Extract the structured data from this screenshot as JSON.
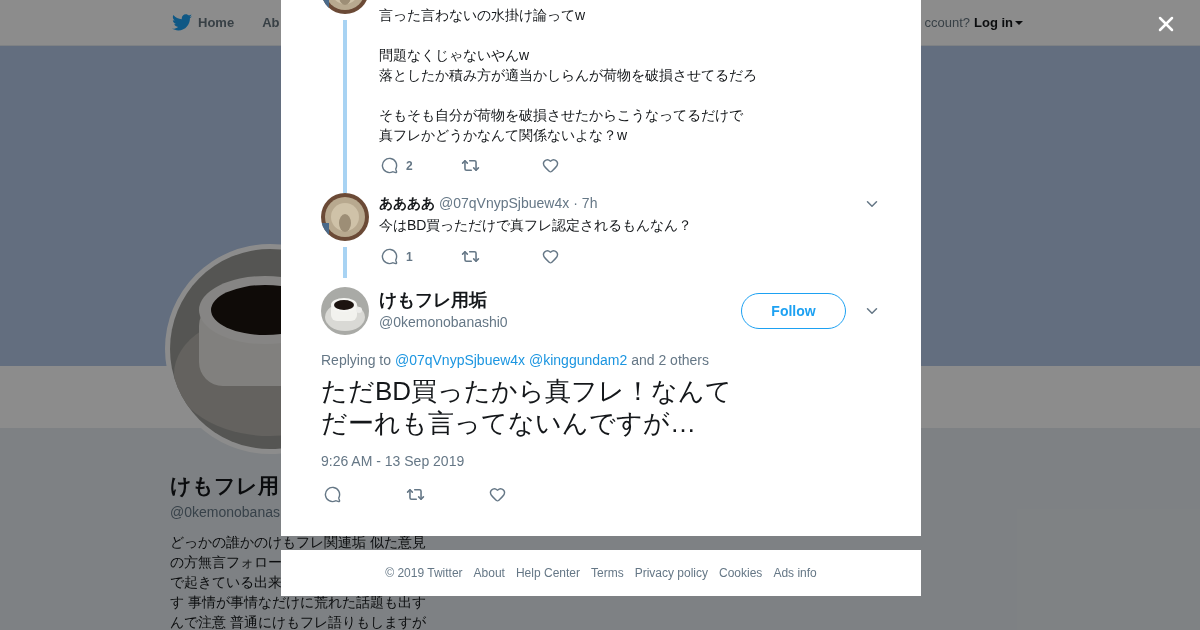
{
  "nav": {
    "home": "Home",
    "about": "Ab",
    "account_prompt": "ccount?",
    "login": "Log in"
  },
  "profile": {
    "name": "けもフレ用",
    "handle": "@0kemonobanas",
    "bio_lines": [
      "どっかの誰かのけもフレ関連垢 似た意見",
      "の方無言フォロー",
      "で起きている出来",
      "す 事情が事情なだけに荒れた話題も出す",
      "んで注意 普通にけもフレ語りもしますが"
    ]
  },
  "thread": [
    {
      "kind": "continued",
      "paragraphs": [
        [
          "言った言わないの水掛け論ってw"
        ],
        [
          "問題なくじゃないやんw",
          "落としたか積み方が適当かしらんが荷物を破損させてるだろ"
        ],
        [
          "そもそも自分が荷物を破損させたからこうなってるだけで",
          "真フレかどうかなんて関係ないよな？w"
        ]
      ],
      "reply_count": "2"
    },
    {
      "kind": "full",
      "name": "ああああ",
      "handle": "@07qVnypSjbuew4x",
      "separator": "·",
      "time": "7h",
      "text": "今はBD買っただけで真フレ認定されるもんなん？",
      "reply_count": "1"
    }
  ],
  "main_tweet": {
    "name": "けもフレ用垢",
    "handle": "@0kemonobanashi0",
    "follow": "Follow",
    "replying_prefix": "Replying to",
    "mentions": [
      "@07qVnypSjbuew4x",
      "@kinggundam2"
    ],
    "replying_suffix": "and 2 others",
    "text_lines": [
      "ただBD買ったから真フレ！なんて",
      "だーれも言ってないんですが…"
    ],
    "timestamp": "9:26 AM - 13 Sep 2019"
  },
  "footer": [
    "© 2019 Twitter",
    "About",
    "Help Center",
    "Terms",
    "Privacy policy",
    "Cookies",
    "Ads info"
  ]
}
